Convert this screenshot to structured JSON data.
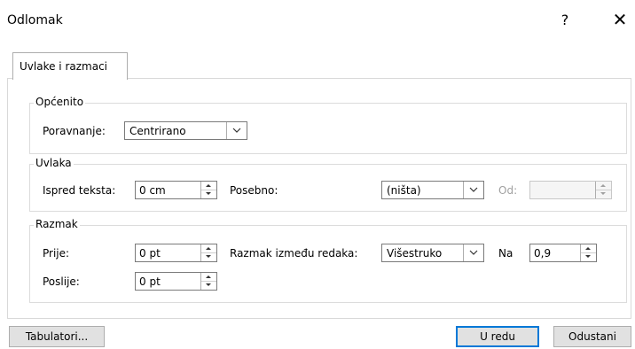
{
  "dialog": {
    "title": "Odlomak",
    "help_icon": "?",
    "close_icon": "✕"
  },
  "tabs": [
    {
      "label": "Uvlake i razmaci"
    }
  ],
  "general": {
    "title": "Općenito",
    "alignment_label": "Poravnanje:",
    "alignment_value": "Centrirano"
  },
  "indent": {
    "title": "Uvlaka",
    "before_text_label": "Ispred teksta:",
    "before_text_value": "0 cm",
    "special_label": "Posebno:",
    "special_value": "(ništa)",
    "by_label": "Od:",
    "by_value": ""
  },
  "spacing": {
    "title": "Razmak",
    "before_label": "Prije:",
    "before_value": "0 pt",
    "after_label": "Poslije:",
    "after_value": "0 pt",
    "line_spacing_label": "Razmak između redaka:",
    "line_spacing_value": "Višestruko",
    "at_label": "Na",
    "at_value": "0,9"
  },
  "footer": {
    "tabs_button": "Tabulatori...",
    "ok_button": "U redu",
    "cancel_button": "Odustani"
  }
}
